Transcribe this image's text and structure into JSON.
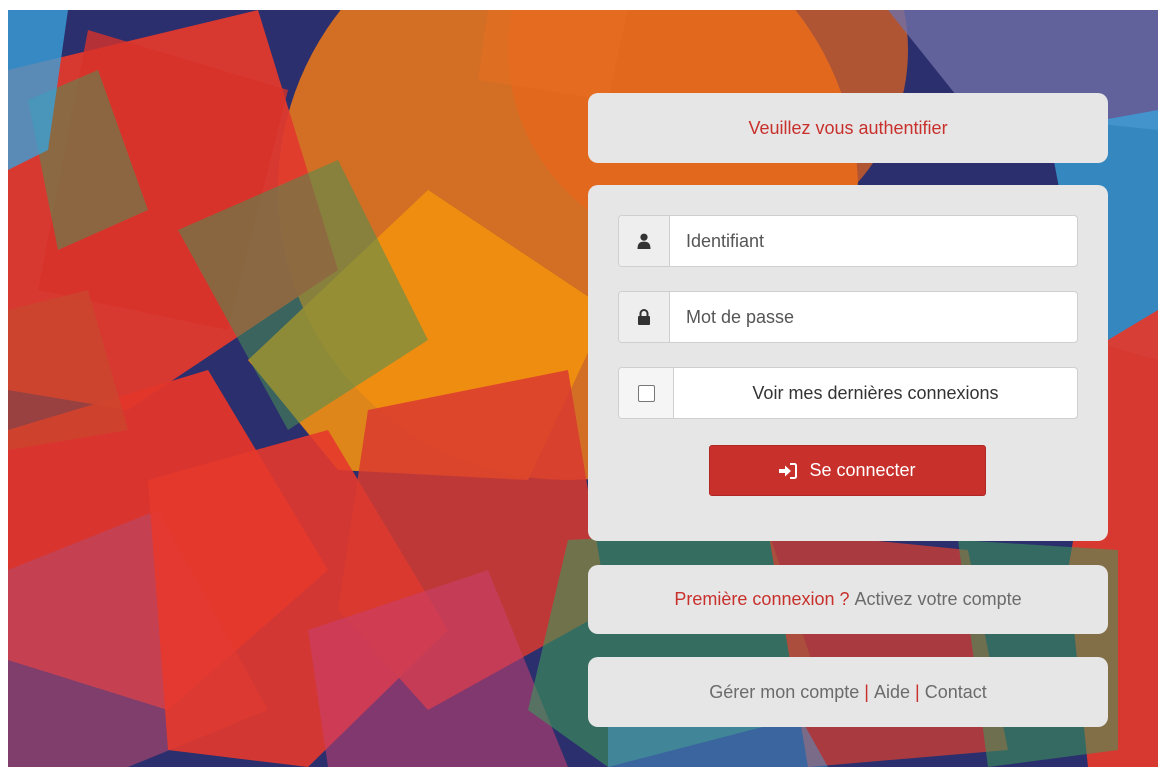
{
  "colors": {
    "accent": "#c8302c",
    "panel_bg": "#e6e6e6",
    "muted_text": "#6b6b6b"
  },
  "header": {
    "title": "Veuillez vous authentifier"
  },
  "form": {
    "username": {
      "placeholder": "Identifiant",
      "value": "",
      "icon": "user-icon"
    },
    "password": {
      "placeholder": "Mot de passe",
      "value": "",
      "icon": "lock-icon"
    },
    "remember": {
      "label": "Voir mes dernières connexions",
      "checked": false
    },
    "submit": {
      "label": "Se connecter",
      "icon": "sign-in-icon"
    }
  },
  "first_login": {
    "question": "Première connexion ?",
    "link": "Activez votre compte"
  },
  "footer_links": {
    "manage": "Gérer mon compte",
    "sep1": "|",
    "help": "Aide",
    "sep2": "|",
    "contact": "Contact"
  }
}
